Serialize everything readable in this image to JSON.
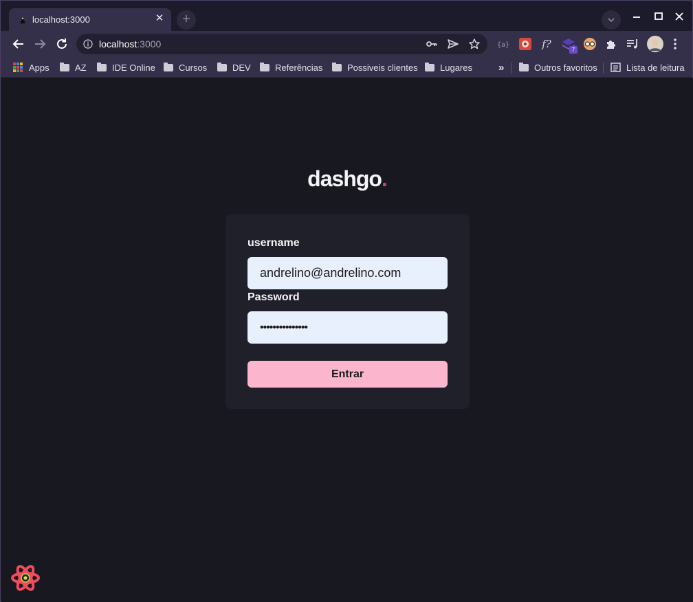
{
  "browser": {
    "tab": {
      "title": "localhost:3000",
      "close_label": "✕"
    },
    "new_tab_label": "+",
    "window_controls": {
      "minimize": "—",
      "maximize": "☐",
      "close": "✕"
    },
    "address": {
      "host": "localhost",
      "port": ":3000"
    },
    "extension_badge": "7",
    "bookmarks": [
      {
        "label": "Apps",
        "icon": "apps-grid-icon"
      },
      {
        "label": "AZ",
        "icon": "folder-icon"
      },
      {
        "label": "IDE Online",
        "icon": "folder-icon"
      },
      {
        "label": "Cursos",
        "icon": "folder-icon"
      },
      {
        "label": "DEV",
        "icon": "folder-icon"
      },
      {
        "label": "Referências",
        "icon": "folder-icon"
      },
      {
        "label": "Possiveis clientes",
        "icon": "folder-icon"
      },
      {
        "label": "Lugares",
        "icon": "folder-icon"
      }
    ],
    "bookmarks_overflow": "»",
    "other_bookmarks": "Outros favoritos",
    "reading_list": "Lista de leitura"
  },
  "page": {
    "logo": {
      "text": "dashgo",
      "dot": "."
    },
    "form": {
      "username_label": "username",
      "username_value": "andrelino@andrelino.com",
      "password_label": "Password",
      "password_value": "•••••••••••••••",
      "submit_label": "Entrar"
    }
  },
  "colors": {
    "background": "#181821",
    "card": "#1f2029",
    "input_bg": "#e8effd",
    "button_bg": "#fbb6ce",
    "accent_dot": "#d53f8c",
    "browser_chrome": "#35304a"
  }
}
